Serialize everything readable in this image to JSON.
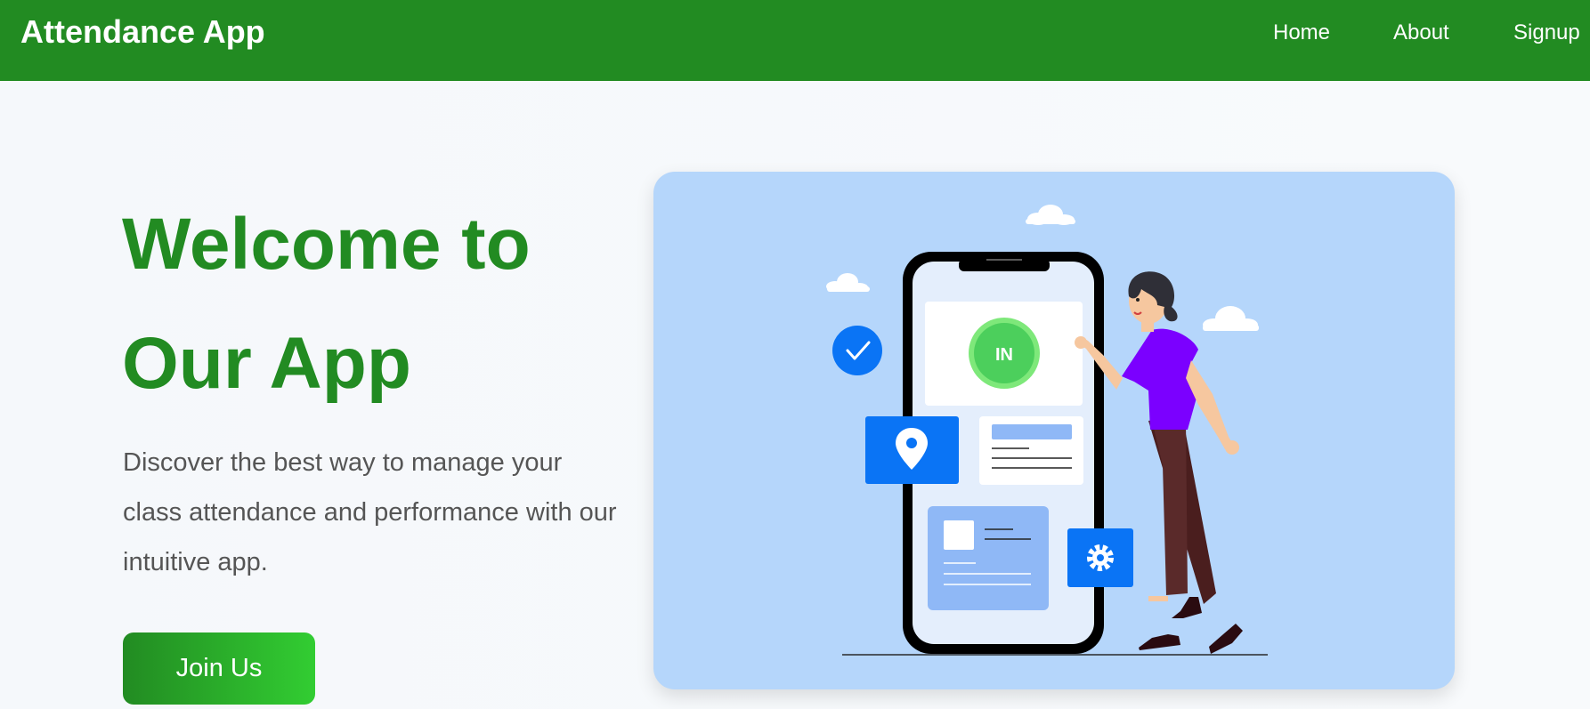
{
  "navbar": {
    "brand": "Attendance App",
    "links": [
      "Home",
      "About",
      "Signup"
    ]
  },
  "hero": {
    "title_line1": "Welcome to",
    "title_line2": "Our App",
    "description": "Discover the best way to manage your class attendance and performance with our intuitive app.",
    "cta_label": "Join Us"
  },
  "illustration": {
    "check_in_label": "IN",
    "icons": [
      "check-icon",
      "location-pin-icon",
      "gear-icon"
    ]
  },
  "colors": {
    "primary_green": "#228b22",
    "accent_green": "#32cd32",
    "illustration_bg": "#b5d6fb",
    "icon_blue": "#0a74f5",
    "shirt_purple": "#7b00ff"
  }
}
